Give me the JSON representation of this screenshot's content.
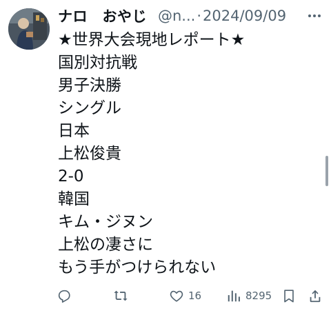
{
  "post": {
    "author": {
      "display_name": "ナロ　おやじ",
      "handle": "@n...",
      "avatar_icon": "user-avatar"
    },
    "separator": "·",
    "date": "2024/09/09",
    "lines": [
      "★世界大会現地レポート★",
      "国別対抗戦",
      "男子決勝",
      "シングル",
      "日本",
      "上松俊貴",
      "2-0",
      "韓国",
      "キム・ジヌン",
      "上松の凄さに",
      "もう手がつけられない"
    ],
    "actions": {
      "reply_icon": "reply-icon",
      "repost_icon": "repost-icon",
      "like_icon": "heart-icon",
      "like_count": "16",
      "views_icon": "views-icon",
      "views_count": "8295",
      "bookmark_icon": "bookmark-icon",
      "share_icon": "share-icon"
    },
    "colors": {
      "text": "#0f1419",
      "secondary": "#536471"
    }
  }
}
